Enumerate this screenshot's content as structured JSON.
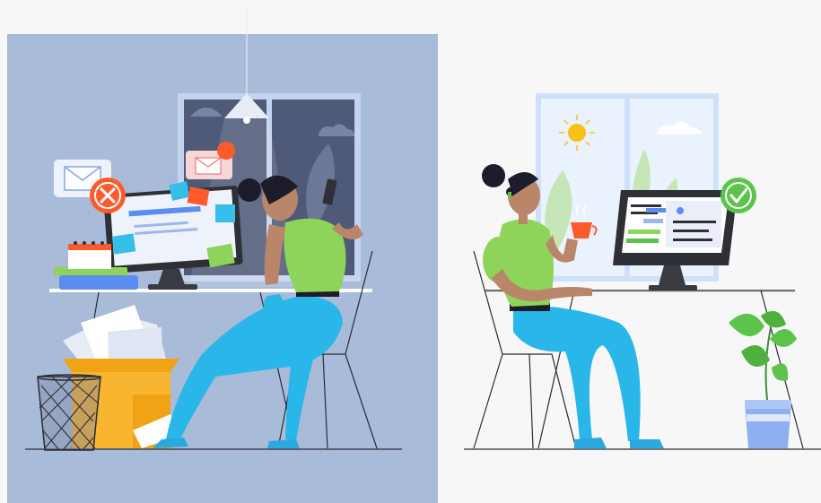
{
  "colors": {
    "page_bg": "#f7f7f7",
    "left_panel_bg": "#a8bbd9",
    "skin": "#b9866a",
    "hair": "#1c1c2a",
    "shirt": "#8ed35a",
    "pants": "#29b6e8",
    "shoes": "#2aa8e0",
    "accent_red": "#ff5a2c",
    "accent_green": "#5cc44a",
    "screen_dark": "#2f2f36",
    "window_night": "#4f5a78",
    "window_day": "#dce9fb",
    "sun": "#f6c21a",
    "pot": "#8fb0f0",
    "box": "#f7b530"
  },
  "scene": {
    "left": {
      "mood": "stressed",
      "icons": [
        "close-icon",
        "envelope-icon",
        "calendar-icon",
        "sticky-note-icon"
      ]
    },
    "right": {
      "mood": "relaxed",
      "icons": [
        "check-icon",
        "sun-icon",
        "coffee-cup-icon",
        "plant-icon"
      ]
    }
  }
}
